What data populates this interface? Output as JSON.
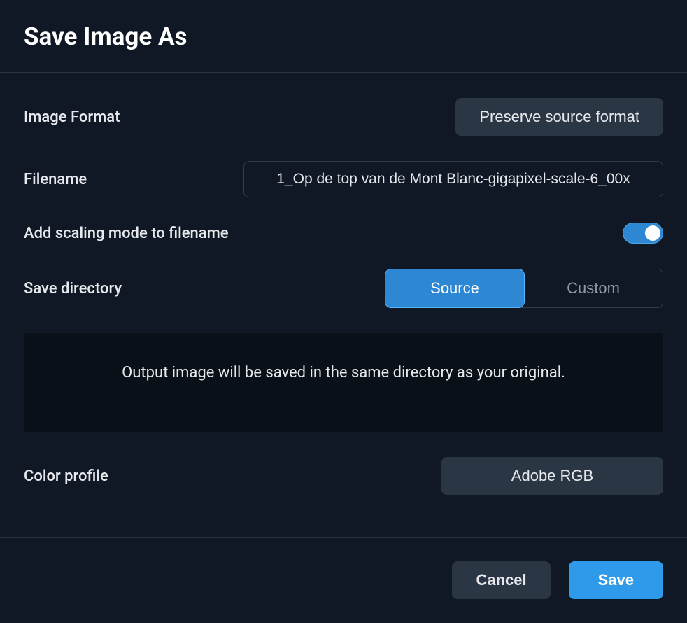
{
  "title": "Save Image As",
  "imageFormat": {
    "label": "Image Format",
    "value": "Preserve source format"
  },
  "filename": {
    "label": "Filename",
    "value": "1_Op de top van de Mont Blanc-gigapixel-scale-6_00x"
  },
  "addScaling": {
    "label": "Add scaling mode to filename",
    "on": true
  },
  "saveDirectory": {
    "label": "Save directory",
    "options": [
      "Source",
      "Custom"
    ],
    "selected": "Source",
    "info": "Output image will be saved in the same directory as your original."
  },
  "colorProfile": {
    "label": "Color profile",
    "value": "Adobe RGB"
  },
  "actions": {
    "cancel": "Cancel",
    "save": "Save"
  }
}
